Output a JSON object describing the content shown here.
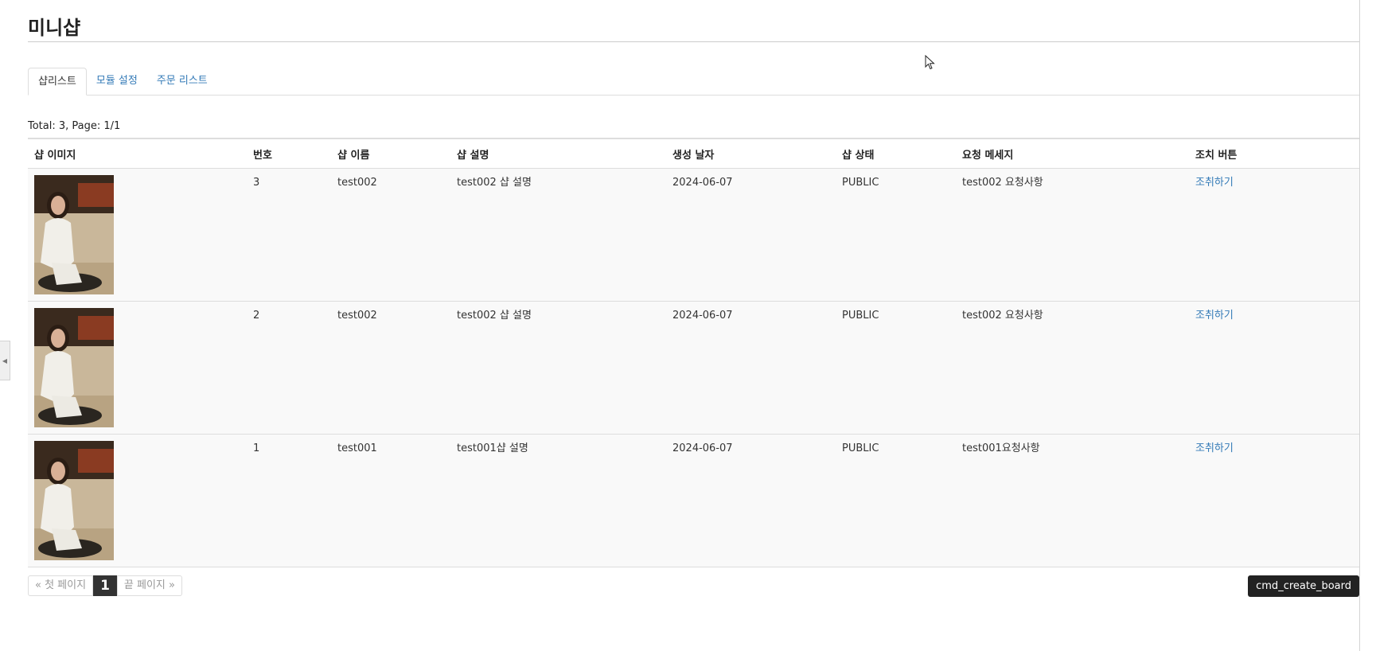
{
  "header": {
    "title": "미니샵"
  },
  "tabs": [
    {
      "label": "샵리스트",
      "active": true
    },
    {
      "label": "모듈 설정",
      "active": false
    },
    {
      "label": "주문 리스트",
      "active": false
    }
  ],
  "summary": "Total: 3, Page: 1/1",
  "table": {
    "columns": [
      "샵 이미지",
      "번호",
      "샵 이름",
      "샵 설명",
      "생성 날자",
      "샵 상태",
      "요청 메세지",
      "조치 버튼"
    ],
    "rows": [
      {
        "number": "3",
        "name": "test002",
        "description": "test002 샵 설명",
        "created": "2024-06-07",
        "status": "PUBLIC",
        "message": "test002 요청사항",
        "action": "조취하기"
      },
      {
        "number": "2",
        "name": "test002",
        "description": "test002 샵 설명",
        "created": "2024-06-07",
        "status": "PUBLIC",
        "message": "test002 요청사항",
        "action": "조취하기"
      },
      {
        "number": "1",
        "name": "test001",
        "description": "test001샵 설명",
        "created": "2024-06-07",
        "status": "PUBLIC",
        "message": "test001요청사항",
        "action": "조취하기"
      }
    ]
  },
  "pagination": {
    "first": "« 첫 페이지",
    "current": "1",
    "last": "끝 페이지 »"
  },
  "buttons": {
    "create": "cmd_create_board"
  },
  "colors": {
    "link": "#337ab7",
    "row_bg": "#f9f9f9",
    "button_bg": "#222222"
  }
}
